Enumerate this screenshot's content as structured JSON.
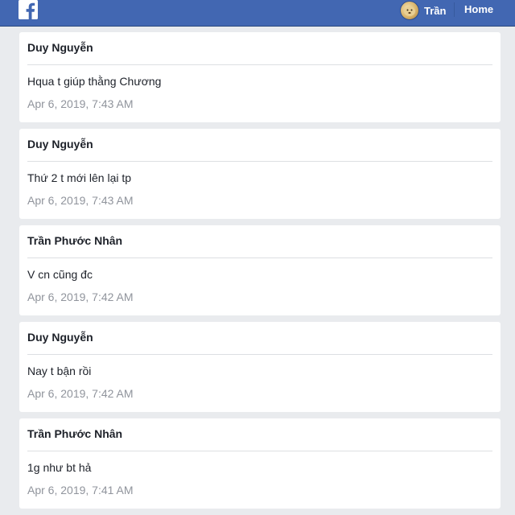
{
  "header": {
    "logo_icon": "facebook-f-icon",
    "brand_color": "#4267b2",
    "user_name": "Trần",
    "home_label": "Home"
  },
  "messages": [
    {
      "author": "Duy Nguyễn",
      "text": "Hqua t giúp thằng Chương",
      "time": "Apr 6, 2019, 7:43 AM"
    },
    {
      "author": "Duy Nguyễn",
      "text": "Thứ 2 t mới lên lại tp",
      "time": "Apr 6, 2019, 7:43 AM"
    },
    {
      "author": "Trần Phước Nhân",
      "text": "V cn cũng đc",
      "time": "Apr 6, 2019, 7:42 AM"
    },
    {
      "author": "Duy Nguyễn",
      "text": "Nay t bận rồi",
      "time": "Apr 6, 2019, 7:42 AM"
    },
    {
      "author": "Trần Phước Nhân",
      "text": "1g như bt hả",
      "time": "Apr 6, 2019, 7:41 AM"
    }
  ]
}
